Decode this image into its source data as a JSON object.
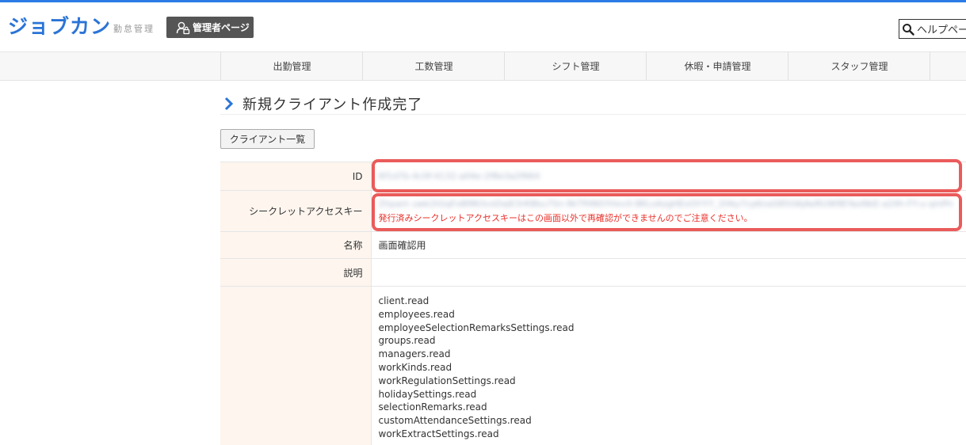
{
  "header": {
    "logo": "ジョブカン",
    "logo_sub": "勤怠管理",
    "admin_page_label": "管理者ページ",
    "help_label": "ヘルプペー"
  },
  "nav": {
    "items": [
      {
        "label": "出勤管理"
      },
      {
        "label": "工数管理"
      },
      {
        "label": "シフト管理"
      },
      {
        "label": "休暇・申請管理"
      },
      {
        "label": "スタッフ管理"
      }
    ]
  },
  "page": {
    "title": "新規クライアント作成完了",
    "client_list_button": "クライアント一覧"
  },
  "details": {
    "id_label": "ID",
    "id_value": "6f1d7b-4c0f-4132-a04e-2f8e3a2f664",
    "secret_label": "シークレットアクセスキー",
    "secret_value": "Zhpam uwk2tGqFxB9N3vxDqiE3rK8bu7Sn-9kTfHNSYHxvX-8KLxAzgHExGY-Y-Y_2Hky7cpKnaS85G6jAeRUW9EYaxNkE-a24h-FY-u-qmPn",
    "secret_warning": "発行済みシークレットアクセスキーはこの画面以外で再確認ができませんのでご注意ください。",
    "name_label": "名称",
    "name_value": "画面確認用",
    "description_label": "説明",
    "description_value": "",
    "scopes": [
      "client.read",
      "employees.read",
      "employeeSelectionRemarksSettings.read",
      "groups.read",
      "managers.read",
      "workKinds.read",
      "workRegulationSettings.read",
      "holidaySettings.read",
      "selectionRemarks.read",
      "customAttendanceSettings.read",
      "workExtractSettings.read"
    ]
  },
  "colors": {
    "brand": "#2a74d6",
    "highlight": "#ea5b5b",
    "warning_text": "#e8302a",
    "label_bg": "#fdf5ee"
  }
}
